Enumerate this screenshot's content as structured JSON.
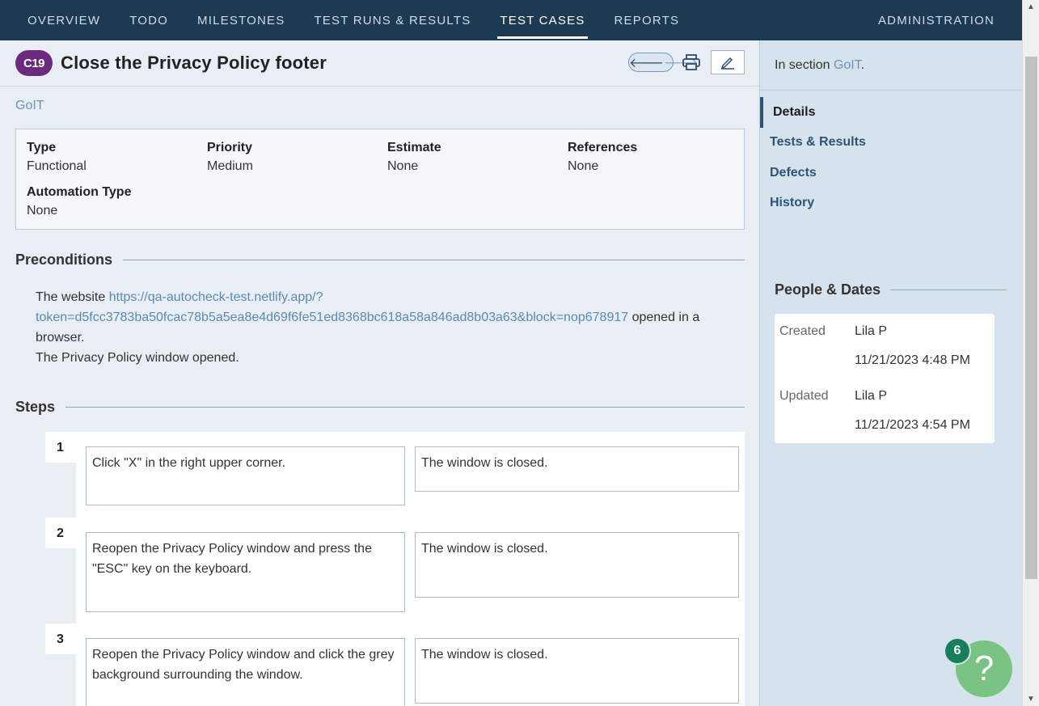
{
  "nav": {
    "tabs": [
      {
        "label": "OVERVIEW"
      },
      {
        "label": "TODO"
      },
      {
        "label": "MILESTONES"
      },
      {
        "label": "TEST RUNS & RESULTS"
      },
      {
        "label": "TEST CASES"
      },
      {
        "label": "REPORTS"
      }
    ],
    "admin_label": "ADMINISTRATION"
  },
  "case": {
    "id": "C19",
    "title": "Close the Privacy Policy footer",
    "section": "GoIT"
  },
  "properties": {
    "type_label": "Type",
    "type_value": "Functional",
    "priority_label": "Priority",
    "priority_value": "Medium",
    "estimate_label": "Estimate",
    "estimate_value": "None",
    "references_label": "References",
    "references_value": "None",
    "automation_label": "Automation Type",
    "automation_value": "None"
  },
  "preconditions": {
    "heading": "Preconditions",
    "prefix": "The website ",
    "url_line1": "https://qa-autocheck-test.netlify.app/?",
    "url_line2": "token=d5fcc3783ba50fcac78b5a5ea8e4d69f6fe51ed8368bc618a58a846ad8b03a63&block=nop678917",
    "suffix": " opened in a browser.",
    "line2": "The Privacy Policy window opened."
  },
  "steps": {
    "heading": "Steps",
    "items": [
      {
        "num": "1",
        "action": "Click \"X\" in the right upper corner.",
        "expected": "The window is closed."
      },
      {
        "num": "2",
        "action": "Reopen the Privacy Policy window and press the \"ESC\" key on the keyboard.",
        "expected": "The window is closed."
      },
      {
        "num": "3",
        "action": "Reopen the Privacy Policy window and click the grey background surrounding the window.",
        "expected": "The window is closed."
      }
    ]
  },
  "sidebar": {
    "in_section_prefix": "In section ",
    "section_link": "GoIT",
    "in_section_suffix": ".",
    "nav": [
      "Details",
      "Tests & Results",
      "Defects",
      "History"
    ],
    "people_heading": "People & Dates",
    "created_label": "Created",
    "created_by": "Lila P",
    "created_date": "11/21/2023 4:48 PM",
    "updated_label": "Updated",
    "updated_by": "Lila P",
    "updated_date": "11/21/2023 4:54 PM"
  },
  "help": {
    "badge_count": "6",
    "icon": "question-icon"
  }
}
